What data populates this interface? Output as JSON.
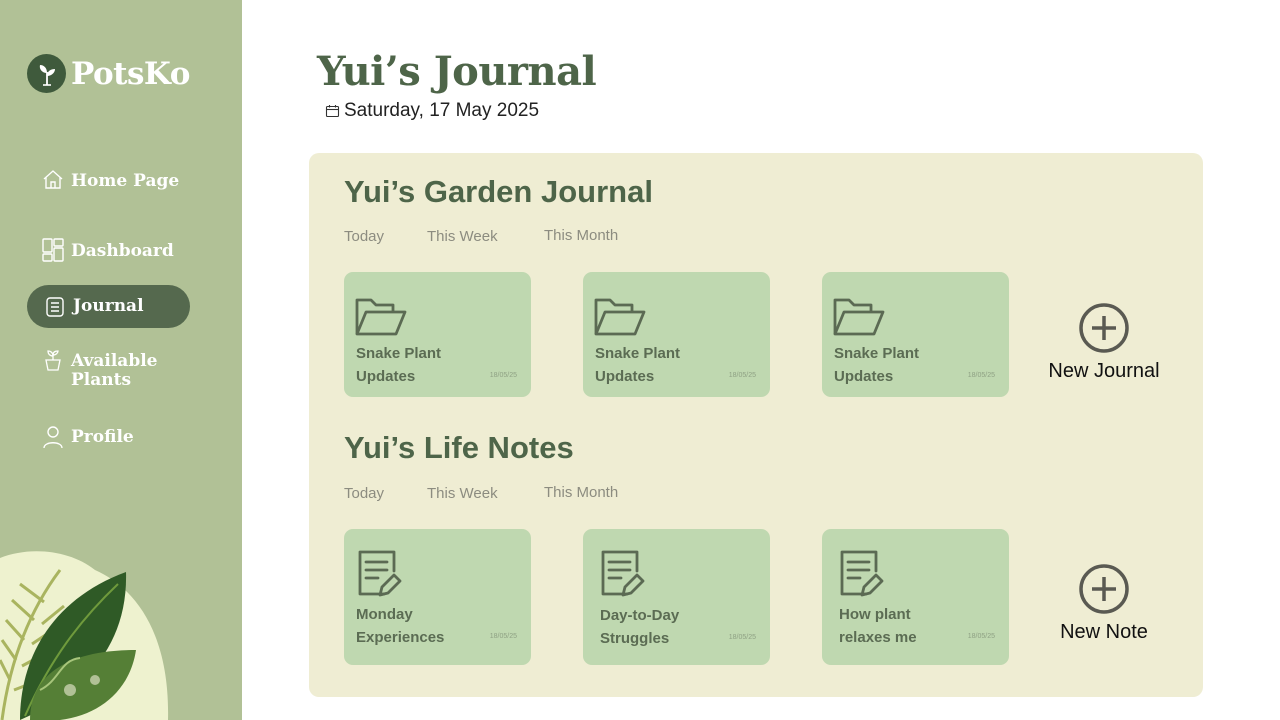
{
  "brand": {
    "name": "PotsKo"
  },
  "nav": {
    "items": [
      {
        "label": "Home Page",
        "icon": "home-icon"
      },
      {
        "label": "Dashboard",
        "icon": "dashboard-icon"
      },
      {
        "label": "Journal",
        "icon": "journal-icon",
        "active": true
      },
      {
        "label": "Available Plants",
        "icon": "plant-pot-icon"
      },
      {
        "label": "Profile",
        "icon": "user-icon"
      }
    ]
  },
  "header": {
    "title": "Yui’s Journal",
    "date": "Saturday, 17 May 2025"
  },
  "garden": {
    "title": "Yui’s Garden Journal",
    "filters": [
      "Today",
      "This Week",
      "This Month"
    ],
    "cards": [
      {
        "line1": "Snake Plant",
        "line2": "Updates",
        "date": "18/05/25",
        "icon": "folder-icon"
      },
      {
        "line1": "Snake Plant",
        "line2": "Updates",
        "date": "18/05/25",
        "icon": "folder-icon"
      },
      {
        "line1": "Snake Plant",
        "line2": "Updates",
        "date": "18/05/25",
        "icon": "folder-icon"
      }
    ],
    "new_label": "New Journal"
  },
  "notes": {
    "title": "Yui’s Life Notes",
    "filters": [
      "Today",
      "This Week",
      "This Month"
    ],
    "cards": [
      {
        "line1": "Monday",
        "line2": "Experiences",
        "date": "18/05/25",
        "icon": "note-edit-icon"
      },
      {
        "line1": "Day-to-Day",
        "line2": "Struggles",
        "date": "18/05/25",
        "icon": "note-edit-icon"
      },
      {
        "line1": "How plant",
        "line2": "relaxes me",
        "date": "18/05/25",
        "icon": "note-edit-icon"
      }
    ],
    "new_label": "New Note"
  },
  "colors": {
    "sidebar": "#b1c196",
    "sidebar_active": "#55694e",
    "accent": "#4e6549",
    "panel": "#efedd3",
    "card": "#bfd8b0"
  }
}
